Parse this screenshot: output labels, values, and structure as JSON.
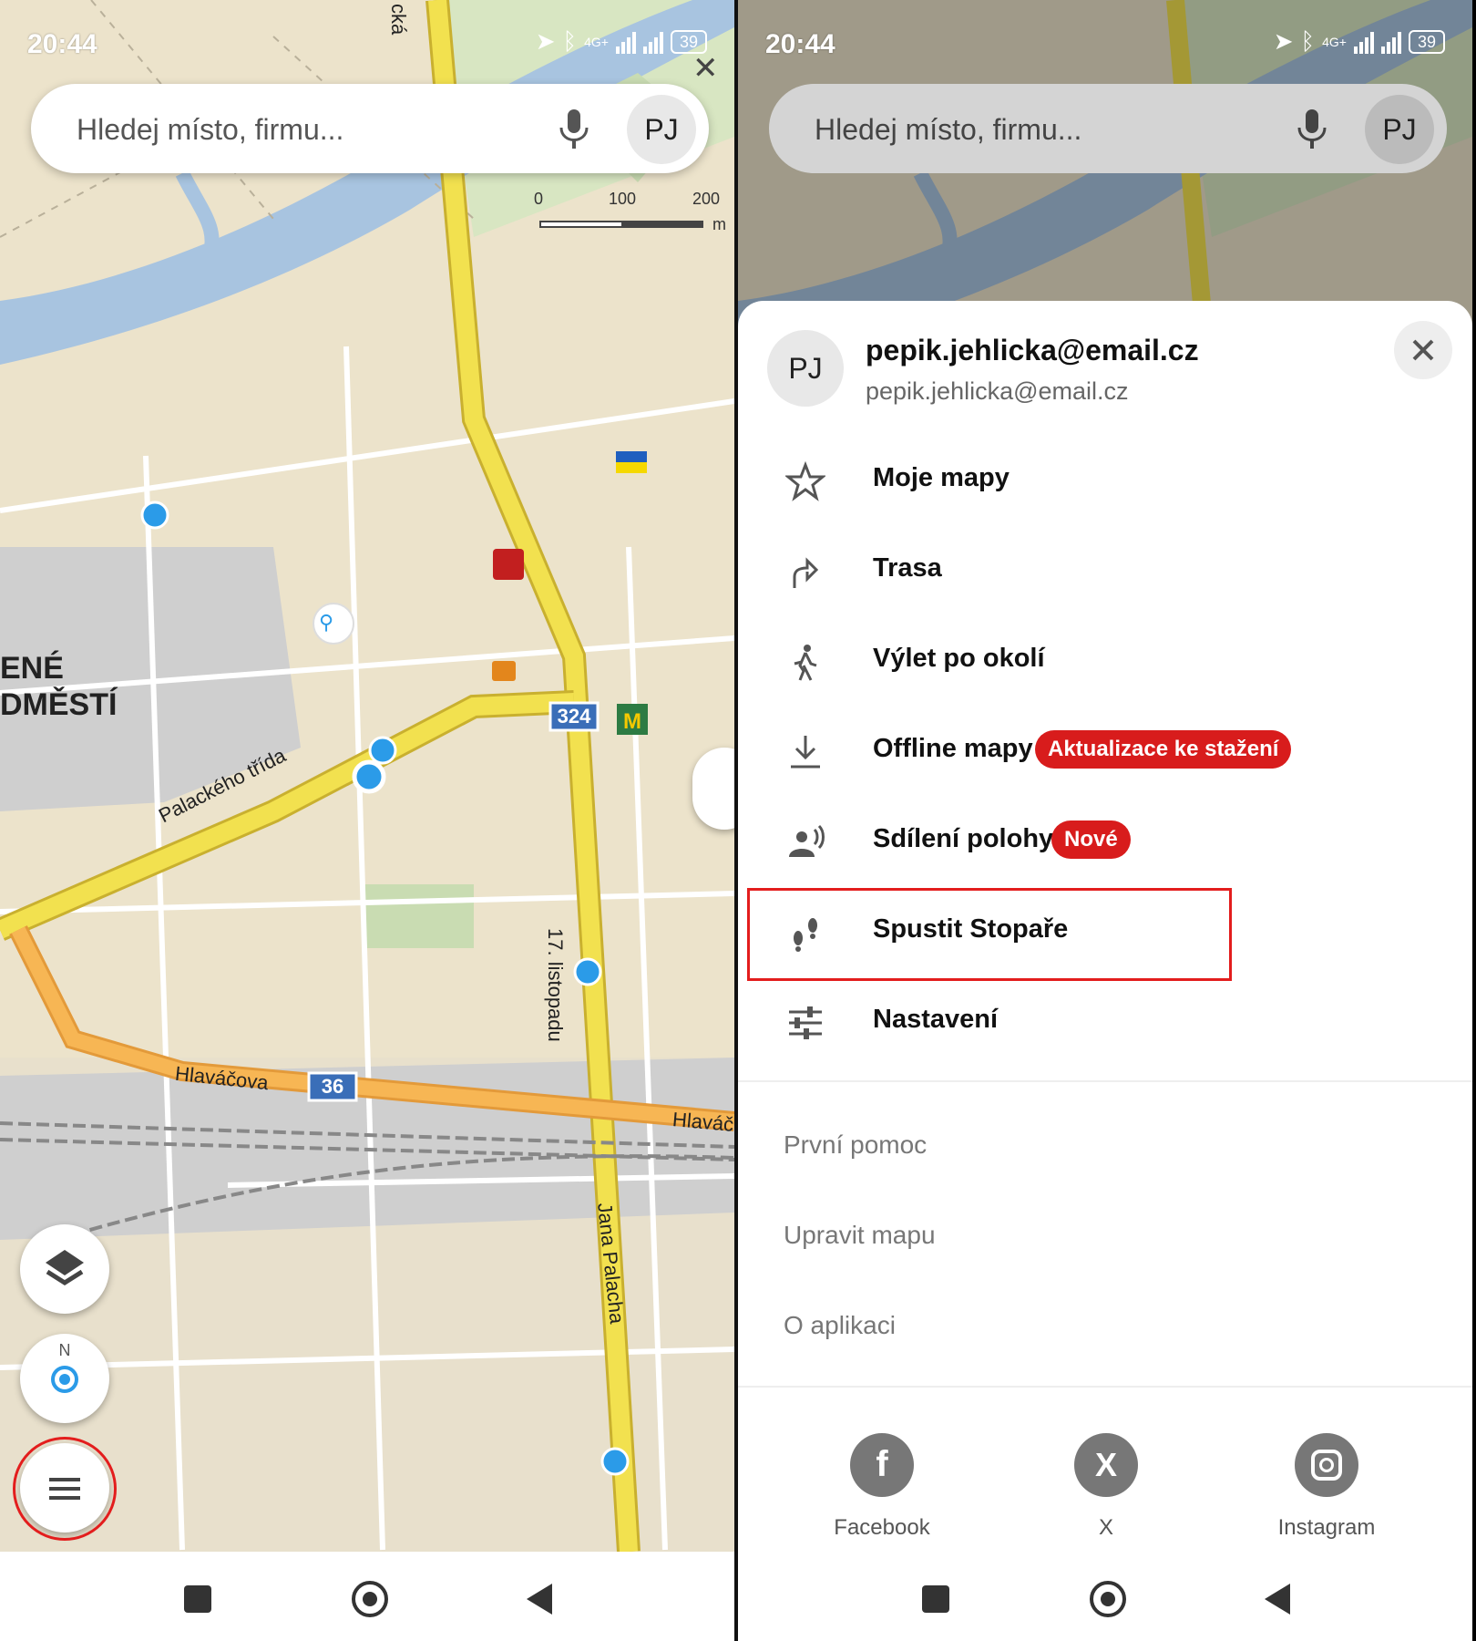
{
  "status": {
    "time": "20:44",
    "network": "4G+",
    "battery": "39"
  },
  "search": {
    "placeholder": "Hledej místo, firmu...",
    "avatar": "PJ"
  },
  "scale": {
    "labels": [
      "0",
      "100",
      "200"
    ],
    "unit": "m"
  },
  "map_labels": {
    "district1": "ENÉ",
    "district2": "DMĚSTÍ",
    "street1": "Palackého třída",
    "street2": "Hlaváčova",
    "street3": "17. listopadu",
    "street4": "Jana Palacha",
    "street5": "Hlaváč",
    "street_top": "cká",
    "road_num1": "324",
    "road_num2": "36"
  },
  "menu": {
    "avatar": "PJ",
    "email_title": "pepik.jehlicka@email.cz",
    "email_sub": "pepik.jehlicka@email.cz",
    "items": [
      {
        "label": "Moje mapy",
        "icon": "star-icon"
      },
      {
        "label": "Trasa",
        "icon": "route-arrow-icon"
      },
      {
        "label": "Výlet po okolí",
        "icon": "hiker-icon"
      },
      {
        "label": "Offline mapy",
        "icon": "download-icon",
        "badge": "Aktualizace ke stažení"
      },
      {
        "label": "Sdílení polohy",
        "icon": "location-share-icon",
        "badge": "Nové"
      },
      {
        "label": "Spustit Stopaře",
        "icon": "footprints-icon"
      },
      {
        "label": "Nastavení",
        "icon": "sliders-icon"
      }
    ],
    "secondary": [
      "První pomoc",
      "Upravit mapu",
      "O aplikaci"
    ],
    "social": [
      "Facebook",
      "X",
      "Instagram"
    ]
  },
  "colors": {
    "highlight": "#e31d1d",
    "badge": "#d81c1c",
    "water": "#a8c4e0",
    "main_road": "#f2e14f",
    "secondary_road": "#f7b654"
  }
}
